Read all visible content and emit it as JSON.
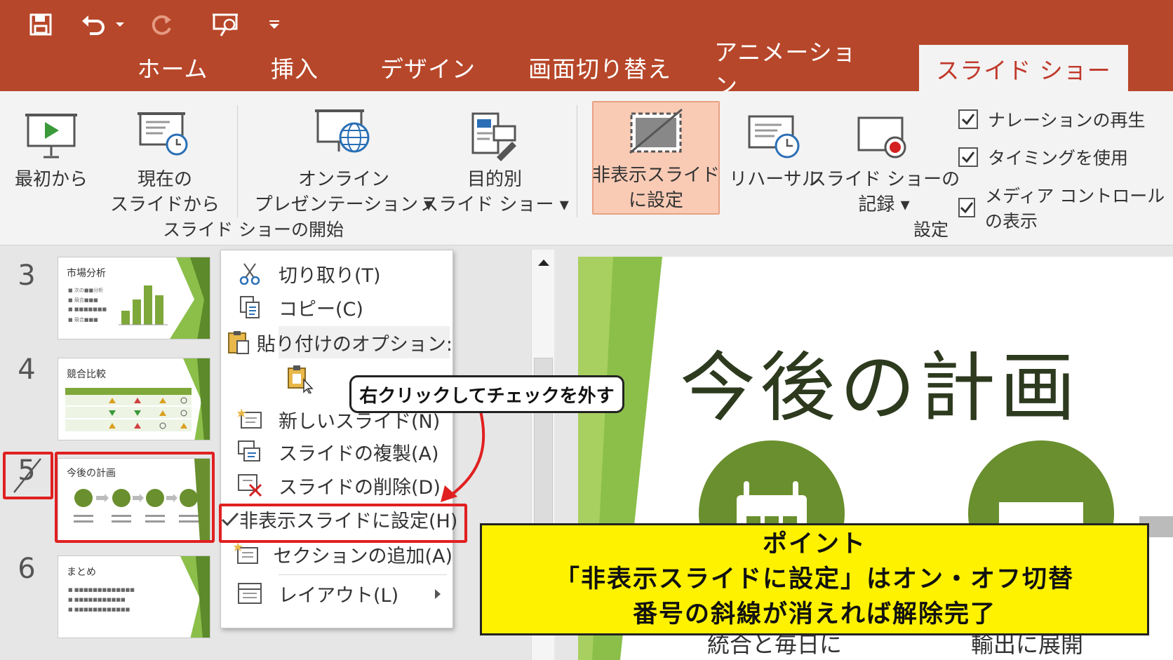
{
  "tabs": [
    "ホーム",
    "挿入",
    "デザイン",
    "画面切り替え",
    "アニメーション",
    "スライド ショー"
  ],
  "ribbon": {
    "from_start": "最初から",
    "from_current": [
      "現在の",
      "スライドから"
    ],
    "online": [
      "オンライン",
      "プレゼンテーション ▾"
    ],
    "custom": [
      "目的別",
      "スライド ショー ▾"
    ],
    "group_start": "スライド ショーの開始",
    "hide_slide": [
      "非表示スライド",
      "に設定"
    ],
    "rehearse": "リハーサル",
    "record": [
      "スライド ショーの",
      "記録 ▾"
    ],
    "group_setup": "設定",
    "checks": [
      "ナレーションの再生",
      "タイミングを使用",
      "メディア コントロールの表示"
    ]
  },
  "slides": [
    {
      "num": "3",
      "title": "市場分析",
      "bullets": [
        "■ 次の■■分析",
        "■ 競合■■■",
        "■ ■■■■■■■",
        "■ 競合■■■"
      ]
    },
    {
      "num": "4",
      "title": "競合比較"
    },
    {
      "num": "5",
      "title": "今後の計画"
    },
    {
      "num": "6",
      "title": "まとめ",
      "bullets": [
        "■ ■■■■■■■■■■■■■",
        "■ ■■■■■■■■■■■",
        "■ ■■■■■■■■■■■■"
      ]
    }
  ],
  "context_menu": {
    "cut": "切り取り(T)",
    "copy": "コピー(C)",
    "paste_options": "貼り付けのオプション:",
    "new_slide": "新しいスライド(N)",
    "duplicate": "スライドの複製(A)",
    "delete": "スライドの削除(D)",
    "hide_slide": "非表示スライドに設定(H)",
    "add_section": "セクションの追加(A)",
    "layout": "レイアウト(L)"
  },
  "callout": "右クリックしてチェックを外す",
  "point": [
    "ポイント",
    "「非表示スライドに設定」はオン・オフ切替",
    "番号の斜線が消えれば解除完了"
  ],
  "slide_main": {
    "title": "今後の計画",
    "caption_left": "統合と毎日に",
    "caption_right": "輸出に展開"
  },
  "colors": {
    "accent": "#b7472a",
    "green": "#6a8f2e",
    "highlight": "#fff200",
    "red": "#e02020"
  }
}
